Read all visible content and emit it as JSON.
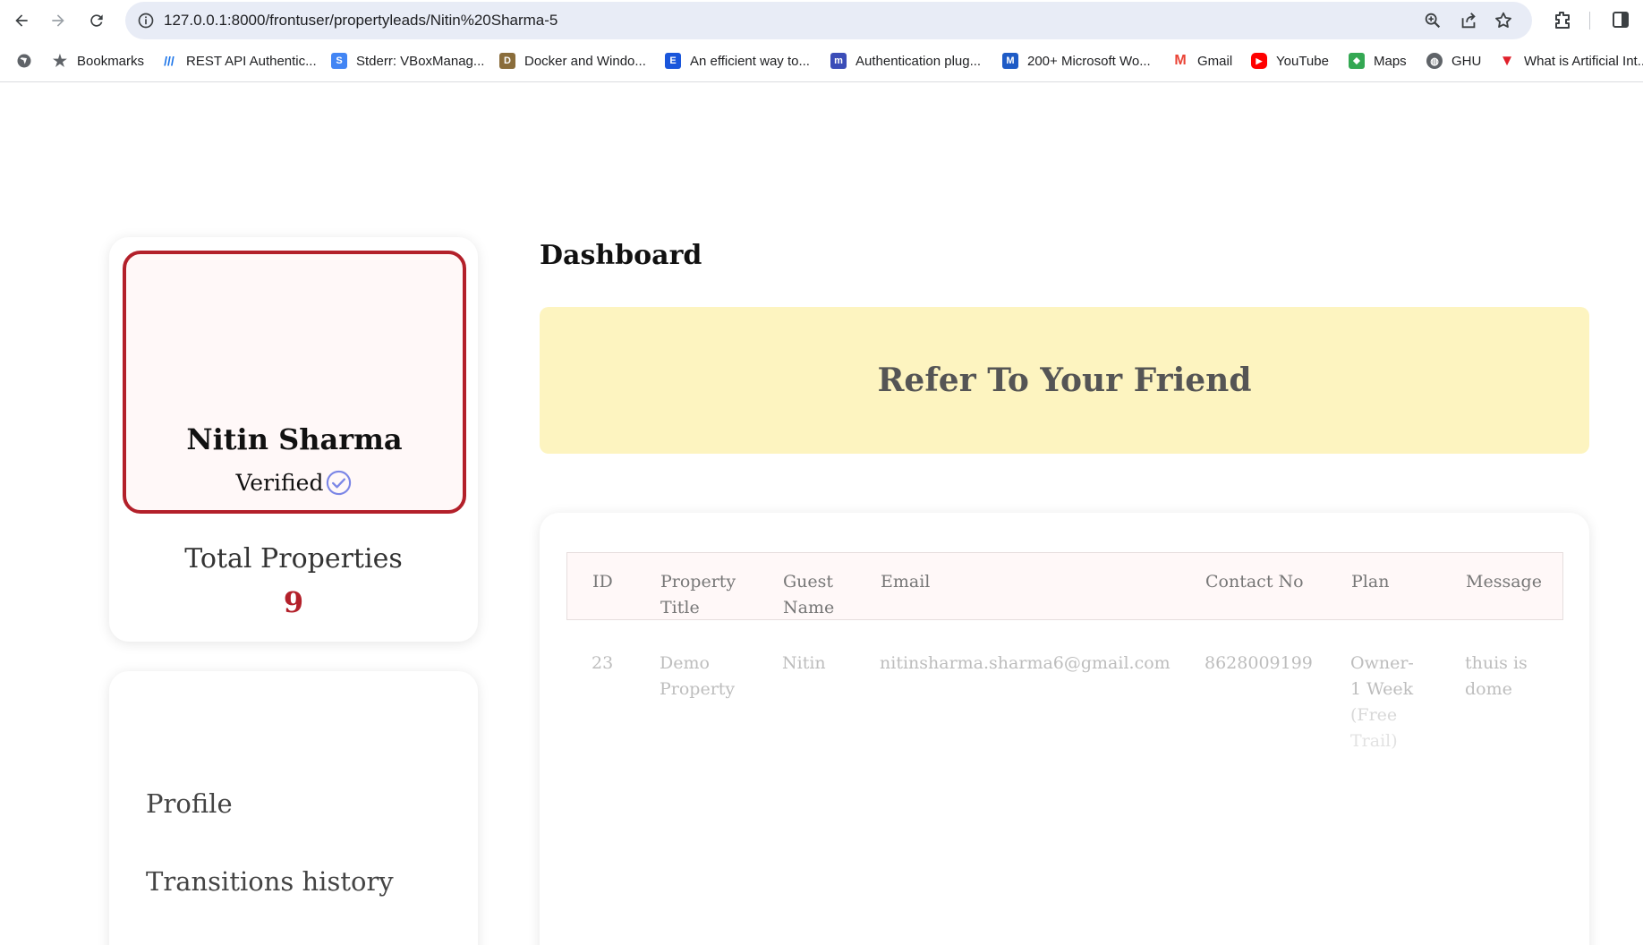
{
  "browser": {
    "url": "127.0.0.1:8000/frontuser/propertyleads/Nitin%20Sharma-5",
    "bookmarks": [
      {
        "label": "Bookmarks"
      },
      {
        "label": "REST API Authentic..."
      },
      {
        "label": "Stderr: VBoxManag..."
      },
      {
        "label": "Docker and Windo..."
      },
      {
        "label": "An efficient way to..."
      },
      {
        "label": "Authentication plug..."
      },
      {
        "label": "200+ Microsoft Wo..."
      },
      {
        "label": "Gmail"
      },
      {
        "label": "YouTube"
      },
      {
        "label": "Maps"
      },
      {
        "label": "GHU"
      },
      {
        "label": "What is Artificial Int..."
      }
    ]
  },
  "profile": {
    "name": "Nitin Sharma",
    "status": "Verified",
    "total_label": "Total Properties",
    "total_value": "9"
  },
  "menu": {
    "items": [
      {
        "label": "Profile"
      },
      {
        "label": "Transitions history"
      }
    ]
  },
  "dashboard": {
    "title": "Dashboard",
    "banner": "Refer To Your Friend"
  },
  "table": {
    "headers": {
      "id": "ID",
      "property_title_1": "Property",
      "property_title_2": "Title",
      "guest_name_1": "Guest",
      "guest_name_2": "Name",
      "email": "Email",
      "contact": "Contact No",
      "plan": "Plan",
      "message": "Message"
    },
    "rows": [
      {
        "id": "23",
        "property_1": "Demo",
        "property_2": "Property",
        "guest": "Nitin",
        "email": "nitinsharma.sharma6@gmail.com",
        "contact": "8628009199",
        "plan_1": "Owner-",
        "plan_2": "1 Week",
        "plan_3": "(Free",
        "plan_4": "Trail)",
        "message_1": "thuis is",
        "message_2": "dome"
      }
    ]
  },
  "colors": {
    "accent": "#b3202a",
    "banner_bg": "#fdf4c0",
    "profile_bg": "#fff8f8",
    "verified_icon": "#7b86e6"
  }
}
